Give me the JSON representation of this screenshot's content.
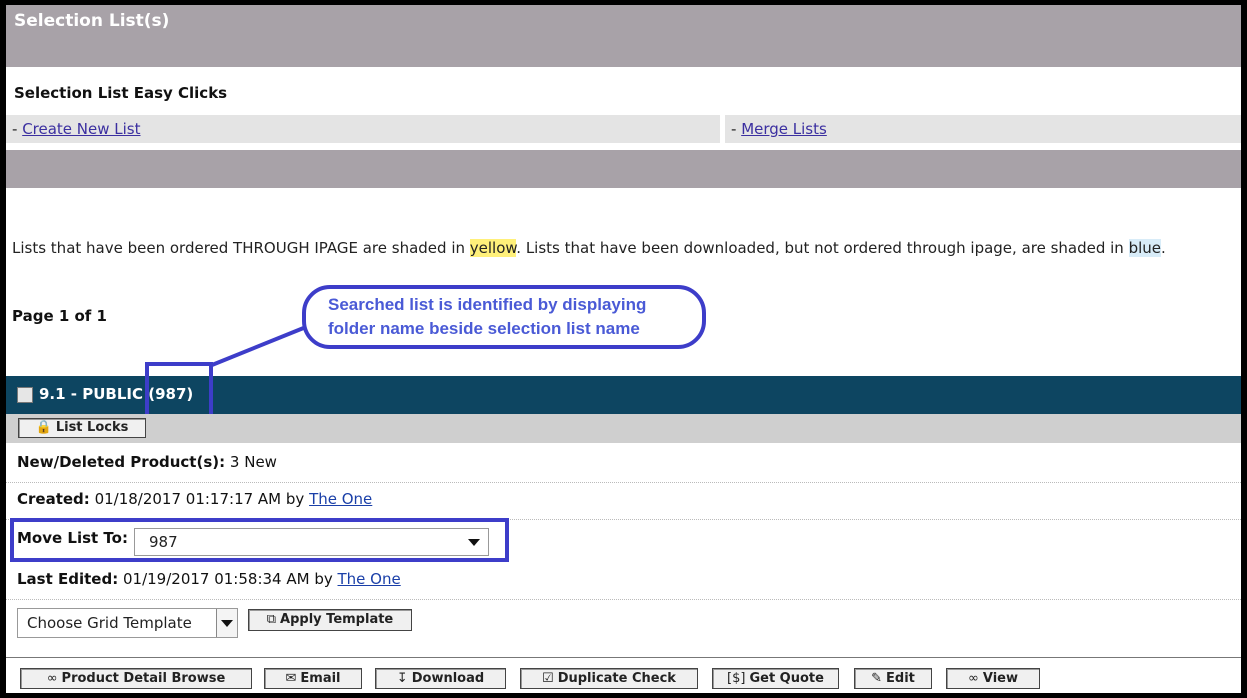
{
  "header": {
    "title": "Selection List(s)"
  },
  "easy_clicks": {
    "title": "Selection List Easy Clicks",
    "create_prefix": "- ",
    "create_label": "Create New List",
    "merge_prefix": "- ",
    "merge_label": "Merge Lists"
  },
  "info": {
    "part1": "Lists that have been ordered THROUGH IPAGE are shaded in ",
    "yellow_word": "yellow",
    "part2": ". Lists that have been downloaded, but not ordered through ipage, are shaded in ",
    "blue_word": "blue",
    "part3": "."
  },
  "pagination": {
    "label": "Page 1 of 1"
  },
  "callout": {
    "line1": "Searched list is identified by displaying",
    "line2": "folder name beside selection list name"
  },
  "list": {
    "name": "9.1 - PUBLIC",
    "folder": "(987)",
    "list_locks_label": "List Locks",
    "new_deleted_label": "New/Deleted Product(s):",
    "new_deleted_value": "3 New",
    "created_label": "Created:",
    "created_value": "01/18/2017 01:17:17 AM by",
    "created_by": "The One",
    "move_label": "Move List To:",
    "move_value": "987",
    "edited_label": "Last Edited:",
    "edited_value": "01/19/2017 01:58:34 AM by",
    "edited_by": "The One",
    "template_value": "Choose Grid Template",
    "apply_template_label": "Apply Template"
  },
  "actions": {
    "product_detail_browse": "Product Detail Browse",
    "email": "Email",
    "download": "Download",
    "duplicate_check": "Duplicate Check",
    "get_quote": "Get Quote",
    "edit": "Edit",
    "view": "View"
  },
  "icons": {
    "browse": "binoculars-icon",
    "email": "envelope-icon",
    "download": "download-icon",
    "duplicate": "check-doc-icon",
    "quote": "dollar-icon",
    "edit": "edit-icon",
    "view": "binoculars-icon",
    "lock": "lock-icon",
    "template": "new-doc-icon"
  },
  "colors": {
    "header_bg": "#a8a2a8",
    "list_bar_bg": "#0d4561",
    "annotation": "#3d3dc9",
    "highlight_yellow": "#fff07a",
    "highlight_blue": "#d8ecf8"
  }
}
